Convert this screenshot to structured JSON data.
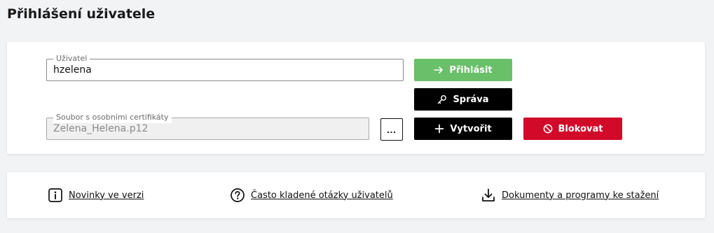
{
  "page": {
    "title": "Přihlášení uživatele"
  },
  "login": {
    "user_label": "Uživatel",
    "user_value": "hzelena",
    "cert_label": "Soubor s osobními certifikáty",
    "cert_value": "Zelena_Helena.p12",
    "browse_label": "...",
    "login_button": "Přihlásit",
    "manage_button": "Správa",
    "create_button": "Vytvořit",
    "block_button": "Blokovat",
    "colors": {
      "login": "#6abf69",
      "dark": "#000000",
      "block": "#d20a2a"
    }
  },
  "links": [
    {
      "label": "Novinky ve verzi",
      "icon": "info-icon"
    },
    {
      "label": "Často kladené otázky uživatelů",
      "icon": "question-icon"
    },
    {
      "label": "Dokumenty a programy ke stažení",
      "icon": "download-icon"
    }
  ]
}
